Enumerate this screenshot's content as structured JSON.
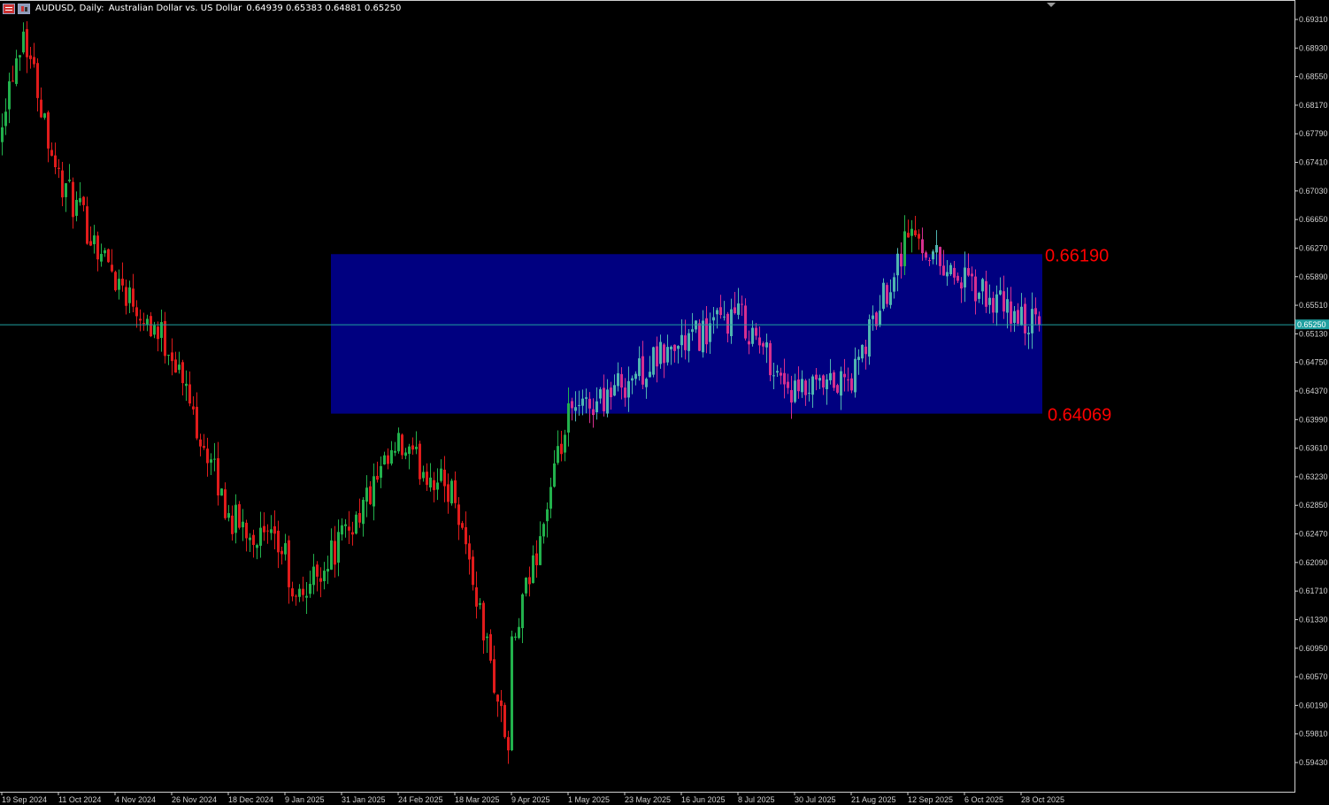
{
  "header": {
    "symbol": "AUDUSD, Daily:",
    "description": "Australian Dollar vs. US Dollar",
    "ohlc": "0.64939 0.65383 0.64881 0.65250"
  },
  "chart_data": {
    "type": "candlestick",
    "ylim": [
      0.5912,
      0.6949
    ],
    "y_ticks": [
      "0.69310",
      "0.68930",
      "0.68550",
      "0.68170",
      "0.67790",
      "0.67410",
      "0.67030",
      "0.66650",
      "0.66270",
      "0.65890",
      "0.65510",
      "0.65130",
      "0.64750",
      "0.64370",
      "0.63990",
      "0.63610",
      "0.63230",
      "0.62850",
      "0.62470",
      "0.62090",
      "0.61710",
      "0.61330",
      "0.60950",
      "0.60570",
      "0.60190",
      "0.59810",
      "0.59430"
    ],
    "x_ticks": [
      "19 Sep 2024",
      "11 Oct 2024",
      "4 Nov 2024",
      "26 Nov 2024",
      "18 Dec 2024",
      "9 Jan 2025",
      "31 Jan 2025",
      "24 Feb 2025",
      "18 Mar 2025",
      "9 Apr 2025",
      "1 May 2025",
      "23 May 2025",
      "16 Jun 2025",
      "8 Jul 2025",
      "30 Jul 2025",
      "21 Aug 2025",
      "12 Sep 2025",
      "6 Oct 2025",
      "28 Oct 2025"
    ],
    "current_price": 0.6525,
    "current_price_label": "0.65250",
    "zone": {
      "upper": 0.6619,
      "lower": 0.64069,
      "upper_label": "0.66190",
      "lower_label": "0.64069",
      "start": "28 Jan 2025",
      "end": "26 Nov 2025"
    },
    "key_points": [
      {
        "date": "19 Sep 2024",
        "close": 0.681
      },
      {
        "date": "27 Sep 2024",
        "close": 0.692
      },
      {
        "date": "11 Oct 2024",
        "close": 0.672
      },
      {
        "date": "4 Nov 2024",
        "close": 0.659
      },
      {
        "date": "26 Nov 2024",
        "close": 0.649
      },
      {
        "date": "18 Dec 2024",
        "close": 0.627
      },
      {
        "date": "9 Jan 2025",
        "close": 0.622
      },
      {
        "date": "13 Jan 2025",
        "close": 0.615
      },
      {
        "date": "31 Jan 2025",
        "close": 0.624
      },
      {
        "date": "24 Feb 2025",
        "close": 0.636
      },
      {
        "date": "18 Mar 2025",
        "close": 0.63
      },
      {
        "date": "8 Apr 2025",
        "close": 0.596
      },
      {
        "date": "9 Apr 2025",
        "close": 0.609
      },
      {
        "date": "1 May 2025",
        "close": 0.64
      },
      {
        "date": "23 May 2025",
        "close": 0.645
      },
      {
        "date": "16 Jun 2025",
        "close": 0.65
      },
      {
        "date": "8 Jul 2025",
        "close": 0.654
      },
      {
        "date": "30 Jul 2025",
        "close": 0.643
      },
      {
        "date": "21 Aug 2025",
        "close": 0.645
      },
      {
        "date": "12 Sep 2025",
        "close": 0.665
      },
      {
        "date": "6 Oct 2025",
        "close": 0.658
      },
      {
        "date": "28 Oct 2025",
        "close": 0.653
      },
      {
        "date": "4 Nov 2025",
        "close": 0.6525
      }
    ],
    "colors": {
      "bull": "#22b14c",
      "bear": "#e01b1b",
      "bull_in_zone": "#4fb5b0",
      "bear_in_zone": "#d62f8f",
      "zone_fill": "#000080",
      "zone_label": "#ff0000",
      "price_line": "#20a0a0",
      "axis": "#d0d0d0",
      "text": "#ffffff",
      "background": "#000000"
    }
  }
}
